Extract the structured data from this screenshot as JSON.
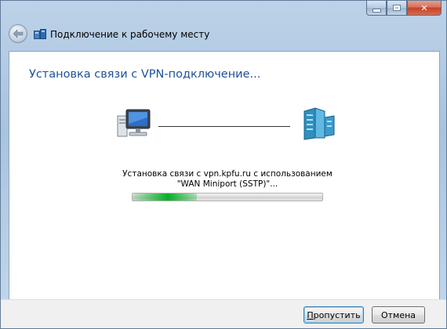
{
  "window": {
    "title": "Подключение к рабочему месту",
    "heading": "Установка связи с VPN-подключение...",
    "status_text": "Установка связи с vpn.kpfu.ru с использованием \"WAN Miniport (SSTP)\"...",
    "progress_fraction": 0.34
  },
  "buttons": {
    "skip_prefix": "",
    "skip_underlined": "П",
    "skip_rest": "ропустить",
    "cancel": "Отмена"
  },
  "colors": {
    "heading": "#1e4f9e",
    "progress_fill": "#06b025",
    "close_button": "#c4422a"
  },
  "icons": {
    "back": "back-arrow-icon",
    "app": "network-connection-icon",
    "computer": "computer-icon",
    "server": "server-icon",
    "minimize": "minimize-icon",
    "maximize": "maximize-icon",
    "close": "close-icon"
  }
}
